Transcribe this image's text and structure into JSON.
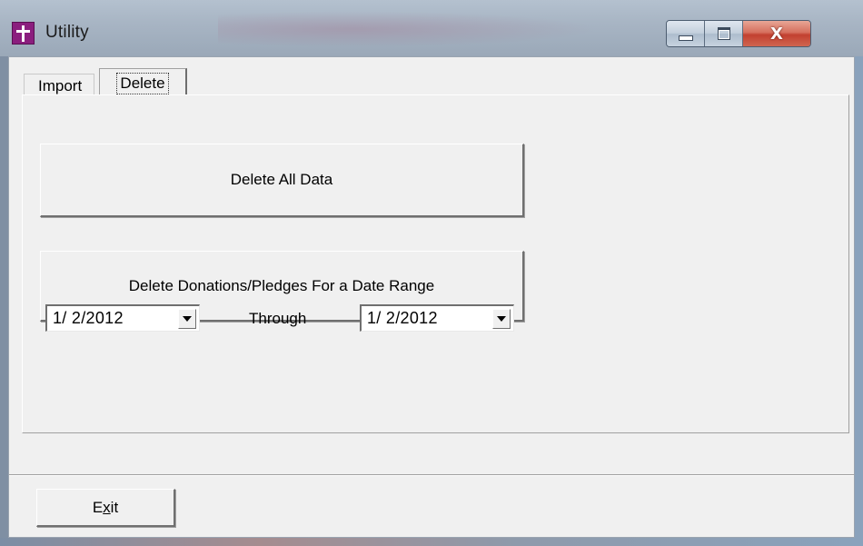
{
  "window": {
    "title": "Utility",
    "icon": "church-cross-icon",
    "controls": {
      "minimize": "minimize-icon",
      "maximize": "maximize-icon",
      "close": "close-icon",
      "close_glyph": "X"
    }
  },
  "tabs": [
    {
      "label": "Import",
      "active": false
    },
    {
      "label": "Delete",
      "active": true
    }
  ],
  "delete_tab": {
    "delete_all_label": "Delete All Data",
    "delete_range_label": "Delete Donations/Pledges For a Date Range",
    "from_date": "1/ 2/2012",
    "through_label": "Through",
    "to_date": "1/ 2/2012"
  },
  "footer": {
    "exit_label_prefix": "E",
    "exit_label_mnemonic": "x",
    "exit_label_suffix": "it"
  },
  "colors": {
    "app_icon": "#8b1e7e",
    "close_button": "#c24030"
  }
}
